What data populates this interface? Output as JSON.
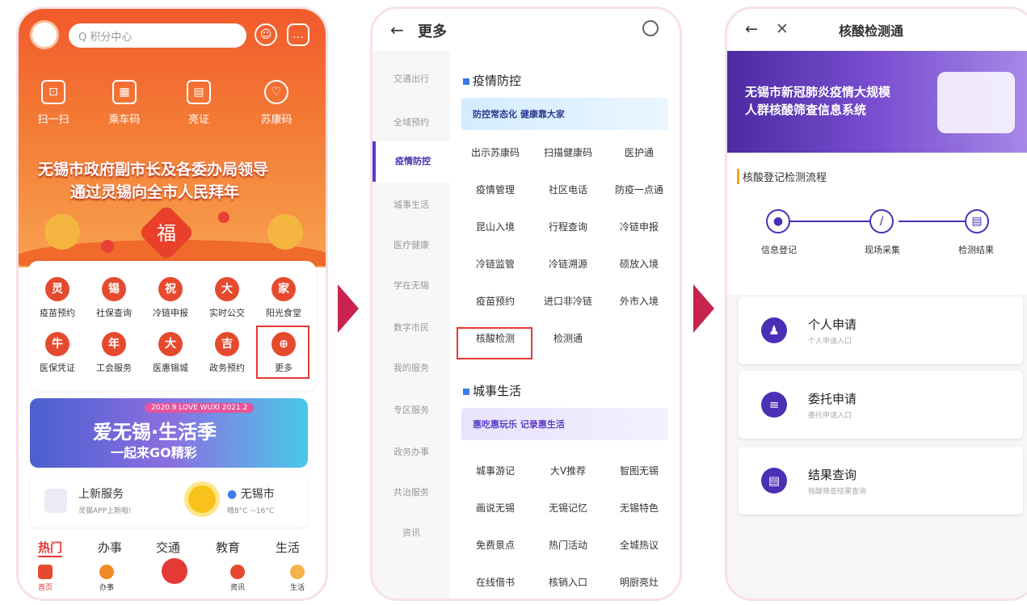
{
  "phone1": {
    "search_placeholder": "Q 积分中心",
    "quick": [
      {
        "label": "扫一扫",
        "icon": "scan-icon"
      },
      {
        "label": "乘车码",
        "icon": "qr-icon"
      },
      {
        "label": "亮证",
        "icon": "id-icon"
      },
      {
        "label": "苏康码",
        "icon": "health-code-icon"
      }
    ],
    "banner_line1": "无锡市政府副市长及各委办局领导",
    "banner_line2": "通过灵锡向全市人民拜年",
    "grid": [
      {
        "glyph": "灵",
        "label": "疫苗预约"
      },
      {
        "glyph": "锡",
        "label": "社保查询"
      },
      {
        "glyph": "祝",
        "label": "冷链申报"
      },
      {
        "glyph": "大",
        "label": "实时公交"
      },
      {
        "glyph": "家",
        "label": "阳光食堂"
      },
      {
        "glyph": "牛",
        "label": "医保凭证"
      },
      {
        "glyph": "年",
        "label": "工会服务"
      },
      {
        "glyph": "大",
        "label": "医惠锡城"
      },
      {
        "glyph": "吉",
        "label": "政务预约"
      },
      {
        "glyph": "⊕",
        "label": "更多"
      }
    ],
    "promo_tag": "2020.9  LOVE WUXI  2021.2",
    "promo_title": "爱无锡·生活季",
    "promo_sub": "一起来GO精彩",
    "info_title": "上新服务",
    "info_sub": "灵锡APP上新啦!",
    "city": "无锡市",
    "weather": "晴8°C ~16°C",
    "tabs": [
      "热门",
      "办事",
      "交通",
      "教育",
      "生活"
    ],
    "nav": [
      "首页",
      "办事",
      "",
      "资讯",
      "生活"
    ]
  },
  "phone2": {
    "title": "更多",
    "back": "←",
    "side": [
      "交通出行",
      "全域预约",
      "疫情防控",
      "城事生活",
      "医疗健康",
      "学在无锡",
      "数字市民",
      "我的服务",
      "专区服务",
      "政务办事",
      "共治服务",
      "资讯"
    ],
    "sec1": "疫情防控",
    "banner1": "防控常态化 健康靠大家",
    "cells1": [
      "出示苏康码",
      "扫描健康码",
      "医护通",
      "疫情管理",
      "社区电话",
      "防疫一点通",
      "昆山入境",
      "行程查询",
      "冷链申报",
      "冷链监管",
      "冷链溯源",
      "硕放入境",
      "疫苗预约",
      "进口非冷链",
      "外市入境",
      "核酸检测",
      "检测通"
    ],
    "sec2": "城事生活",
    "banner2": "惠吃惠玩乐 记录惠生活",
    "cells2": [
      "城事游记",
      "大V推荐",
      "智图无锡",
      "画说无锡",
      "无锡记忆",
      "无锡特色",
      "免费景点",
      "热门活动",
      "全城热议",
      "在线借书",
      "核销入口",
      "明厨亮灶"
    ]
  },
  "phone3": {
    "back": "←",
    "close": "✕",
    "title": "核酸检测通",
    "banner1": "无锡市新冠肺炎疫情大规模",
    "banner2": "人群核酸筛查信息系统",
    "proc_title": "核酸登记检测流程",
    "steps": [
      "信息登记",
      "现场采集",
      "检测结果"
    ],
    "cards": [
      {
        "title": "个人申请",
        "sub": "个人申请入口"
      },
      {
        "title": "委托申请",
        "sub": "委托申请入口"
      },
      {
        "title": "结果查询",
        "sub": "核酸筛查结果查询"
      }
    ]
  },
  "colors": {
    "accent": "#4b2fb5",
    "orange": "#f25a2c",
    "arrow": "#c8234d",
    "highlight": "#e53935"
  }
}
